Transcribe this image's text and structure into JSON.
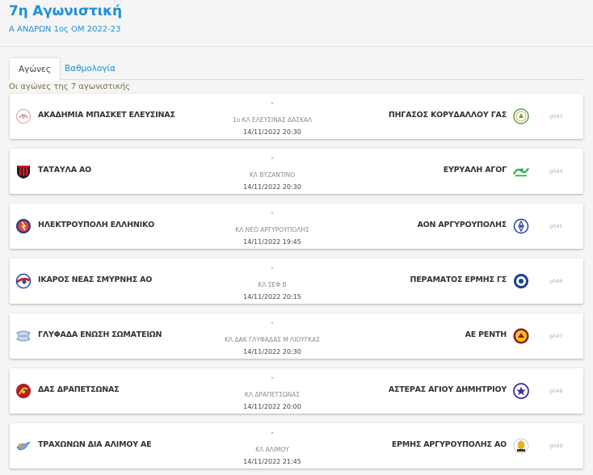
{
  "header": {
    "round_title": "7η Αγωνιστική",
    "competition": "Α ΑΝΔΡΩΝ 1ος ΟΜ 2022-23"
  },
  "tabs": [
    {
      "label": "Αγώνες",
      "active": true
    },
    {
      "label": "Βαθμολογία",
      "active": false
    }
  ],
  "section_label": "Οι αγώνες της 7 αγωνιστικής",
  "colors": {
    "accent": "#1d8fd6",
    "section_label": "#7a6d3a"
  },
  "matches": [
    {
      "home": "ΑΚΑΔΗΜΙΑ ΜΠΑΣΚΕΤ ΕΛΕΥΣΙΝΑΣ",
      "home_logo": "basketball-academy-logo-icon",
      "away": "ΠΗΓΑΣΟΣ ΚΟΡΥΔΑΛΛΟΥ ΓΑΣ",
      "away_logo": "pegasus-logo-icon",
      "score": "-",
      "venue": "1ο ΚΛ ΕΛΕΥΣΙΝΑΣ ΔΑΣΚΑΛ",
      "datetime": "14/11/2022 20:30",
      "code": "g043"
    },
    {
      "home": "ΤΑΤΑΥΛΑ ΑΟ",
      "home_logo": "tatavla-shield-icon",
      "away": "ΕΥΡΥΑΛΗ ΑΓΟΓ",
      "away_logo": "evryali-logo-icon",
      "score": "-",
      "venue": "ΚΛ ΒΥΖΑΝΤΙΝΟ",
      "datetime": "14/11/2022 20:30",
      "code": "g044"
    },
    {
      "home": "ΗΛΕΚΤΡΟΥΠΟΛΗ ΕΛΛΗΝΙΚΟ",
      "home_logo": "ilektroupoli-logo-icon",
      "away": "ΑΟΝ ΑΡΓΥΡΟΥΠΟΛΗΣ",
      "away_logo": "aon-logo-icon",
      "score": "-",
      "venue": "ΚΛ ΝΕΟ ΑΡΓΥΡΟΥΠΟΛΗΣ",
      "datetime": "14/11/2022 19:45",
      "code": "g045"
    },
    {
      "home": "ΙΚΑΡΟΣ ΝΕΑΣ ΣΜΥΡΝΗΣ ΑΟ",
      "home_logo": "ikaros-logo-icon",
      "away": "ΠΕΡΑΜΑΤΟΣ ΕΡΜΗΣ ΓΣ",
      "away_logo": "peramatos-logo-icon",
      "score": "-",
      "venue": "ΚΛ ΣΕΦ Β",
      "datetime": "14/11/2022 20:15",
      "code": "g046"
    },
    {
      "home": "ΓΛΥΦΑΔΑ ΕΝΩΣΗ ΣΩΜΑΤΕΙΩΝ",
      "home_logo": "glyfada-logo-icon",
      "away": "ΑΕ ΡΕΝΤΗ",
      "away_logo": "rentis-logo-icon",
      "score": "-",
      "venue": "ΚΛ ΔΑΚ ΓΛΥΦΑΔΑΣ Μ ΛΙΟΥΓΚΑΣ",
      "datetime": "14/11/2022 20:30",
      "code": "g047"
    },
    {
      "home": "ΔΑΣ ΔΡΑΠΕΤΣΩΝΑΣ",
      "home_logo": "drapetsona-logo-icon",
      "away": "ΑΣΤΕΡΑΣ ΑΓΙΟΥ ΔΗΜΗΤΡΙΟΥ",
      "away_logo": "asteras-star-icon",
      "score": "-",
      "venue": "ΚΛ ΔΡΑΠΕΤΣΩΝΑΣ",
      "datetime": "14/11/2022 20:00",
      "code": "g048"
    },
    {
      "home": "ΤΡΑΧΩΝΩΝ ΔΙΑ ΑΛΙΜΟΥ ΑΕ",
      "home_logo": "trachones-logo-icon",
      "away": "ΕΡΜΗΣ ΑΡΓΥΡΟΥΠΟΛΗΣ ΑΟ",
      "away_logo": "ermis-logo-icon",
      "score": "-",
      "venue": "ΚΛ ΑΛΙΜΟΥ",
      "datetime": "14/11/2022 21:45",
      "code": "g049"
    }
  ]
}
